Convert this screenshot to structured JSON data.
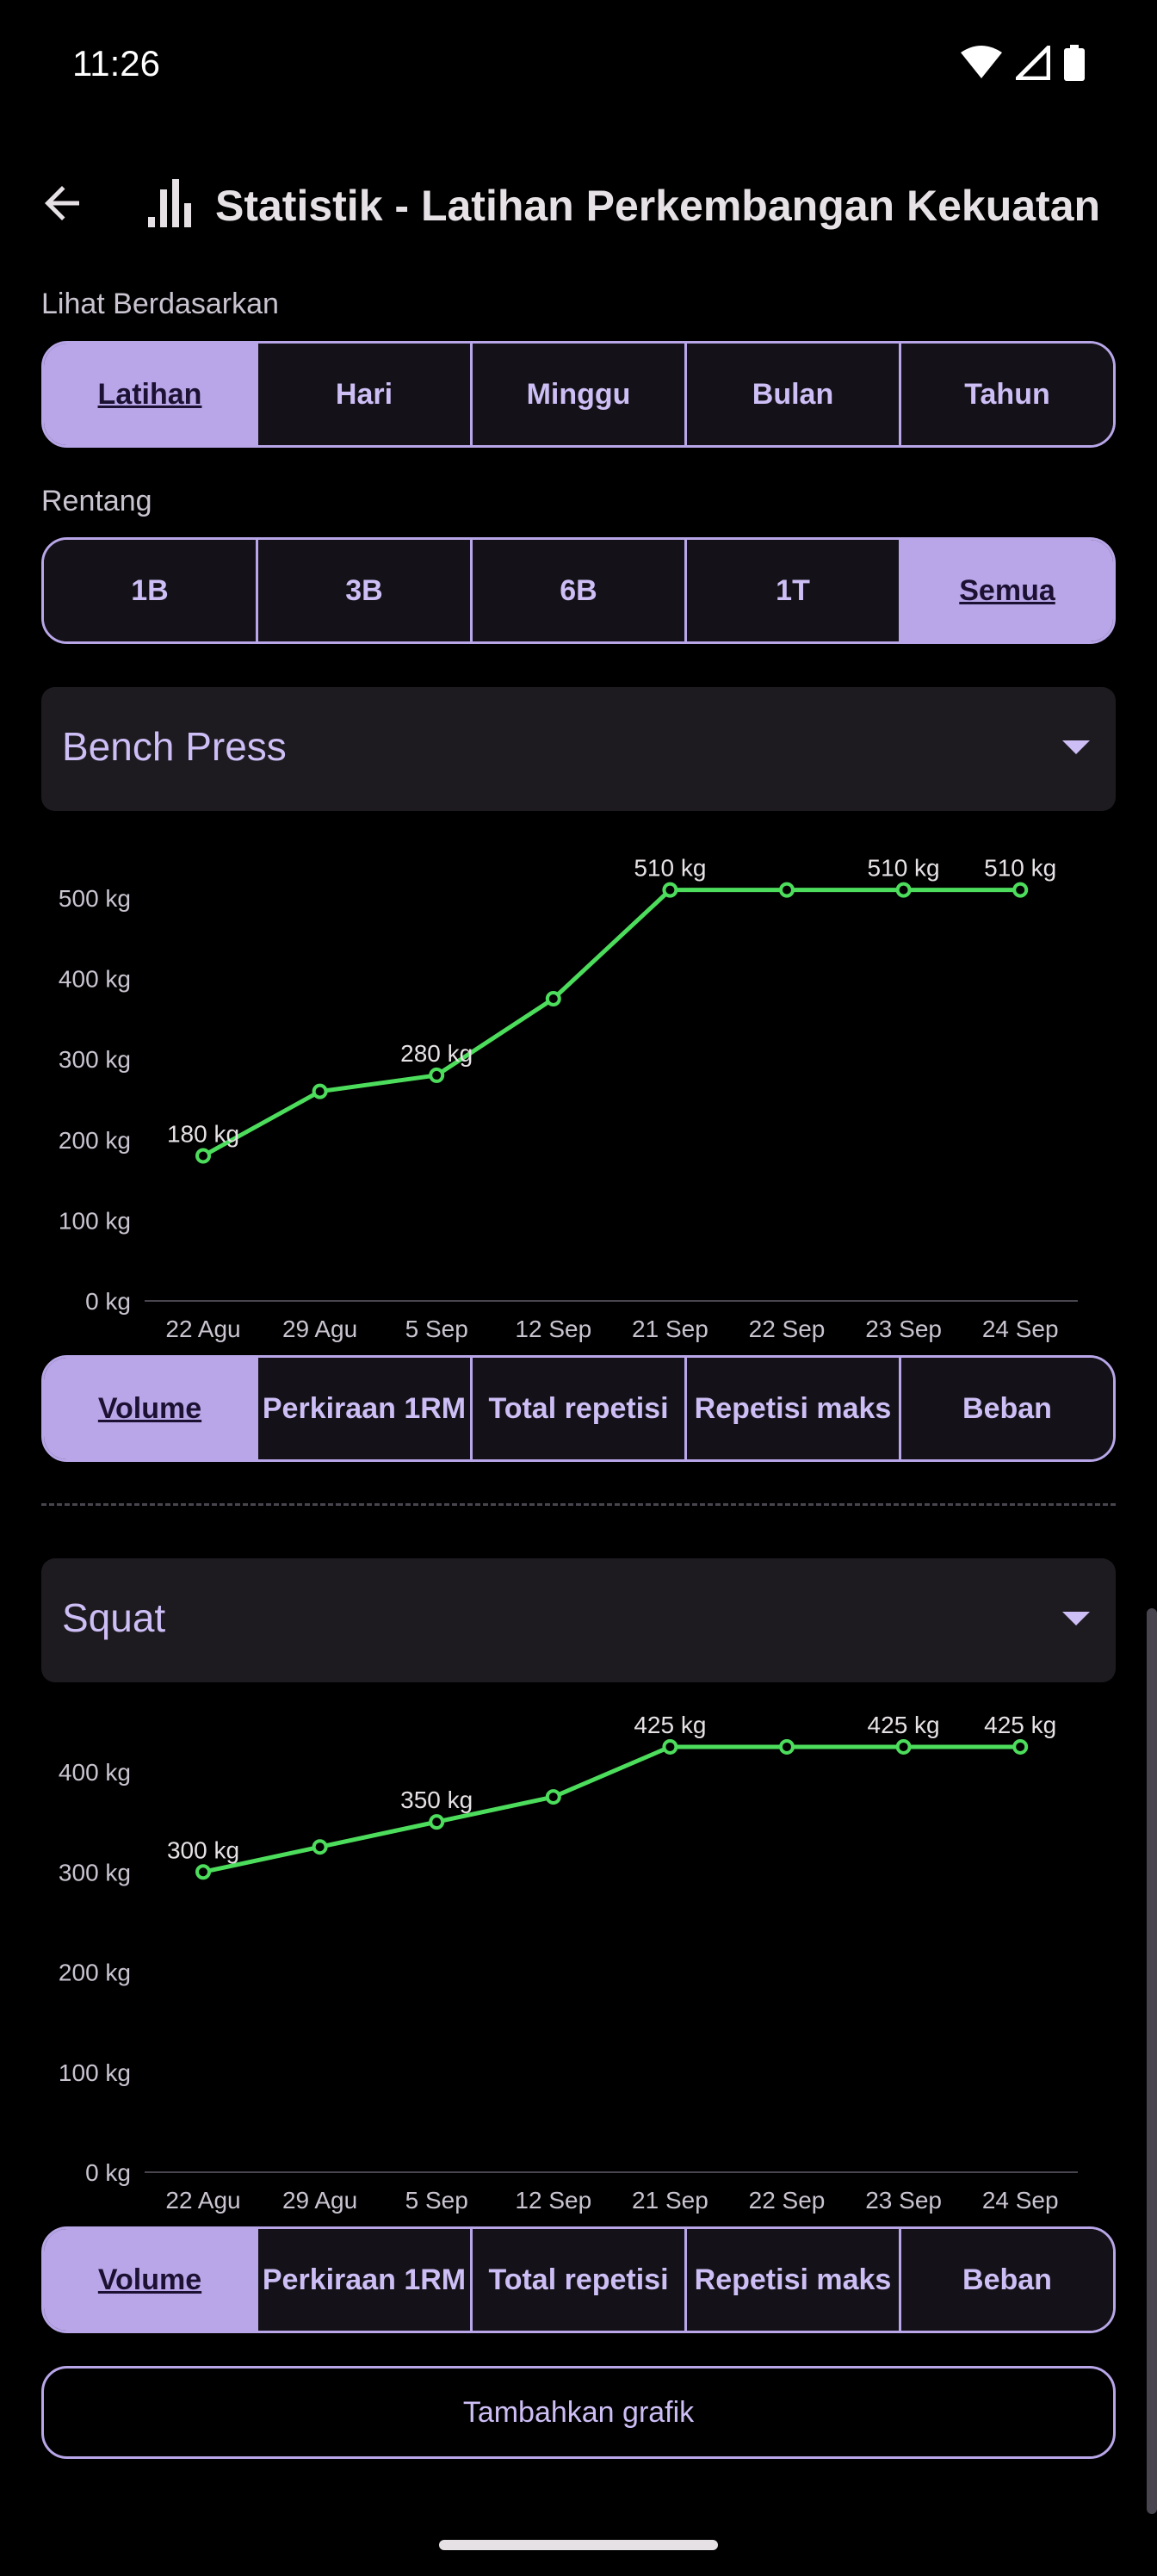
{
  "status": {
    "time": "11:26"
  },
  "app_bar": {
    "title": "Statistik - Latihan Perkembangan Kekuatan"
  },
  "view_by": {
    "label": "Lihat Berdasarkan",
    "options": [
      "Latihan",
      "Hari",
      "Minggu",
      "Bulan",
      "Tahun"
    ],
    "selected": "Latihan"
  },
  "range": {
    "label": "Rentang",
    "options": [
      "1B",
      "3B",
      "6B",
      "1T",
      "Semua"
    ],
    "selected": "Semua"
  },
  "charts": [
    {
      "exercise": "Bench Press",
      "metrics": [
        "Volume",
        "Perkiraan 1RM",
        "Total repetisi",
        "Repetisi maks",
        "Beban"
      ],
      "selected_metric": "Volume"
    },
    {
      "exercise": "Squat",
      "metrics": [
        "Volume",
        "Perkiraan 1RM",
        "Total repetisi",
        "Repetisi maks",
        "Beban"
      ],
      "selected_metric": "Volume"
    }
  ],
  "chart_data": [
    {
      "type": "line",
      "categories": [
        "22 Agu",
        "29 Agu",
        "5 Sep",
        "12 Sep",
        "21 Sep",
        "22 Sep",
        "23 Sep",
        "24 Sep"
      ],
      "values": [
        180,
        260,
        280,
        375,
        510,
        510,
        510,
        510
      ],
      "data_labels": [
        "180 kg",
        "",
        "280 kg",
        "",
        "510 kg",
        "",
        "510 kg",
        "510 kg"
      ],
      "yticks": [
        "0 kg",
        "100 kg",
        "200 kg",
        "300 kg",
        "400 kg",
        "500 kg"
      ],
      "ylim": [
        0,
        500
      ],
      "line_color": "#4ddd5c"
    },
    {
      "type": "line",
      "categories": [
        "22 Agu",
        "29 Agu",
        "5 Sep",
        "12 Sep",
        "21 Sep",
        "22 Sep",
        "23 Sep",
        "24 Sep"
      ],
      "values": [
        300,
        325,
        350,
        375,
        425,
        425,
        425,
        425
      ],
      "data_labels": [
        "300 kg",
        "",
        "350 kg",
        "",
        "425 kg",
        "",
        "425 kg",
        "425 kg"
      ],
      "yticks": [
        "0 kg",
        "100 kg",
        "200 kg",
        "300 kg",
        "400 kg"
      ],
      "ylim": [
        0,
        400
      ],
      "line_color": "#4ddd5c"
    }
  ],
  "add_chart": {
    "label": "Tambahkan grafik"
  },
  "colors": {
    "accent": "#b8a6e8",
    "line": "#4ddd5c",
    "background": "#000000"
  }
}
